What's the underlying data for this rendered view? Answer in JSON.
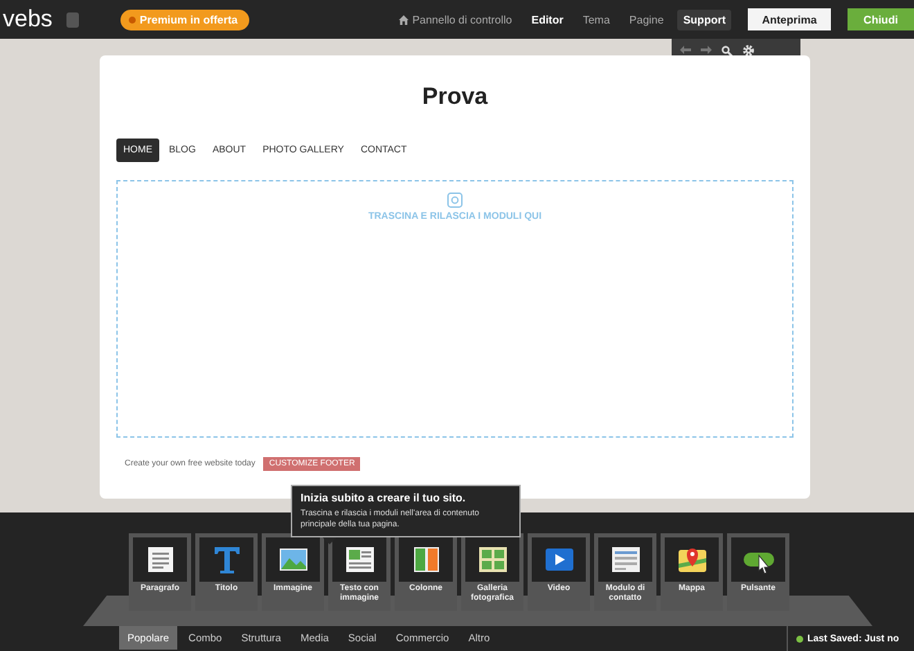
{
  "topbar": {
    "logo": "vebs",
    "promo": "Premium in offerta",
    "nav": [
      {
        "label": "Pannello di controllo",
        "kind": "home",
        "selected": false
      },
      {
        "label": "Editor",
        "kind": "plain",
        "selected": true
      },
      {
        "label": "Tema",
        "kind": "plain",
        "selected": false
      },
      {
        "label": "Pagine",
        "kind": "plain",
        "selected": false
      },
      {
        "label": "Support",
        "kind": "boxed",
        "selected": true
      }
    ],
    "buttons": [
      {
        "label": "Anteprima",
        "kind": "light"
      },
      {
        "label": "Chiudi",
        "kind": "green"
      }
    ]
  },
  "site": {
    "title": "Prova",
    "menu": [
      {
        "label": "HOME",
        "selected": true
      },
      {
        "label": "BLOG",
        "selected": false
      },
      {
        "label": "ABOUT",
        "selected": false
      },
      {
        "label": "PHOTO GALLERY",
        "selected": false
      },
      {
        "label": "CONTACT",
        "selected": false
      }
    ],
    "dropzone": "TRASCINA E RILASCIA I MODULI QUI",
    "footer_text": "Create your own free website today",
    "footer_button": "CUSTOMIZE FOOTER"
  },
  "tooltip": {
    "title": "Inizia subito a creare il tuo sito.",
    "body": "Trascina e rilascia i moduli nell'area di contenuto principale della tua pagina."
  },
  "modules": [
    {
      "label": "Paragrafo",
      "kind": "paragraph"
    },
    {
      "label": "Titolo",
      "kind": "title"
    },
    {
      "label": "Immagine",
      "kind": "image"
    },
    {
      "label": "Testo con immagine",
      "kind": "text-image"
    },
    {
      "label": "Colonne",
      "kind": "columns"
    },
    {
      "label": "Galleria fotografica",
      "kind": "gallery"
    },
    {
      "label": "Video",
      "kind": "video"
    },
    {
      "label": "Modulo di contatto",
      "kind": "form"
    },
    {
      "label": "Mappa",
      "kind": "map"
    },
    {
      "label": "Pulsante",
      "kind": "button"
    }
  ],
  "categories": [
    {
      "label": "Popolare",
      "selected": true
    },
    {
      "label": "Combo",
      "selected": false
    },
    {
      "label": "Struttura",
      "selected": false
    },
    {
      "label": "Media",
      "selected": false
    },
    {
      "label": "Social",
      "selected": false
    },
    {
      "label": "Commercio",
      "selected": false
    },
    {
      "label": "Altro",
      "selected": false
    }
  ],
  "status": "Last Saved: Just no"
}
